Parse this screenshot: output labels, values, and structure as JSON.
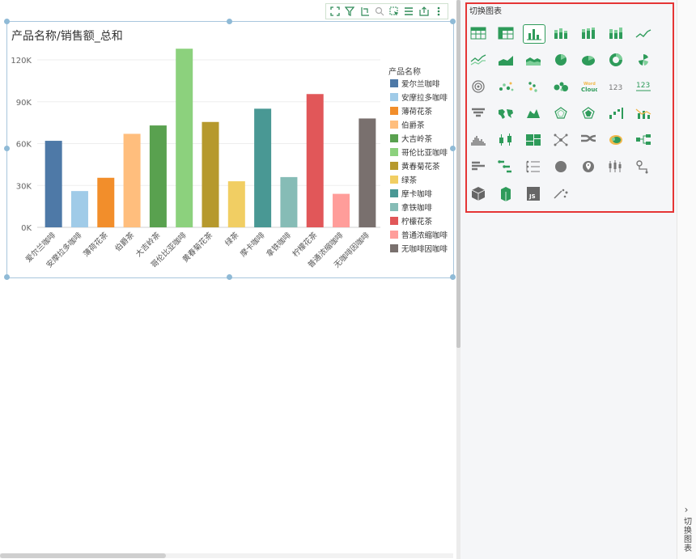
{
  "chart_title": "产品名称/销售额_总和",
  "toolbar_icons": [
    "fullscreen-icon",
    "filter-icon",
    "drill-icon",
    "zoom-icon",
    "select-icon",
    "list-icon",
    "export-icon",
    "more-icon"
  ],
  "panel": {
    "title": "切换图表",
    "toggle_label": "切换图表"
  },
  "chart_types": [
    "table",
    "crosstab",
    "column",
    "stacked-column",
    "percent-column",
    "grouped-column",
    "line",
    "multi-line",
    "area",
    "stacked-area",
    "pie",
    "ellipse-pie",
    "donut",
    "rose",
    "radial",
    "bubble-scatter",
    "scatter",
    "bubble",
    "word-cloud",
    "kpi",
    "multi-kpi",
    "funnel",
    "world-map",
    "geo-map",
    "radar",
    "filled-radar",
    "waterfall",
    "bar-line",
    "histogram",
    "boxplot",
    "treemap",
    "network",
    "sankey",
    "heat-map",
    "tree",
    "bar",
    "gantt",
    "dot-list",
    "point-map",
    "geo-point",
    "candlestick",
    "route-map",
    "cube",
    "3d-column",
    "js-chart",
    "particle"
  ],
  "selected_chart_type": "column",
  "chart_data": {
    "type": "bar",
    "title": "产品名称/销售额_总和",
    "xlabel": "",
    "ylabel": "",
    "ylim": [
      0,
      120000
    ],
    "yticks": [
      0,
      30000,
      60000,
      90000,
      120000
    ],
    "ytick_labels": [
      "0K",
      "30K",
      "60K",
      "90K",
      "120K"
    ],
    "grid": true,
    "legend_title": "产品名称",
    "legend_position": "right",
    "categories": [
      "爱尔兰咖啡",
      "安摩拉多咖啡",
      "薄荷花茶",
      "伯爵茶",
      "大吉岭茶",
      "哥伦比亚咖啡",
      "黄春菊花茶",
      "绿茶",
      "摩卡咖啡",
      "拿铁咖啡",
      "柠檬花茶",
      "普通浓缩咖啡",
      "无咖啡因咖啡"
    ],
    "values": [
      62000,
      26000,
      35500,
      67000,
      73000,
      128000,
      75500,
      33000,
      85000,
      36000,
      95500,
      24000,
      78000
    ],
    "colors": [
      "#4e79a7",
      "#a0cbe8",
      "#f28e2b",
      "#ffbe7d",
      "#59a14f",
      "#8cd17d",
      "#b6992d",
      "#f1ce63",
      "#499894",
      "#86bcb6",
      "#e15759",
      "#ff9d9a",
      "#79706e"
    ]
  }
}
